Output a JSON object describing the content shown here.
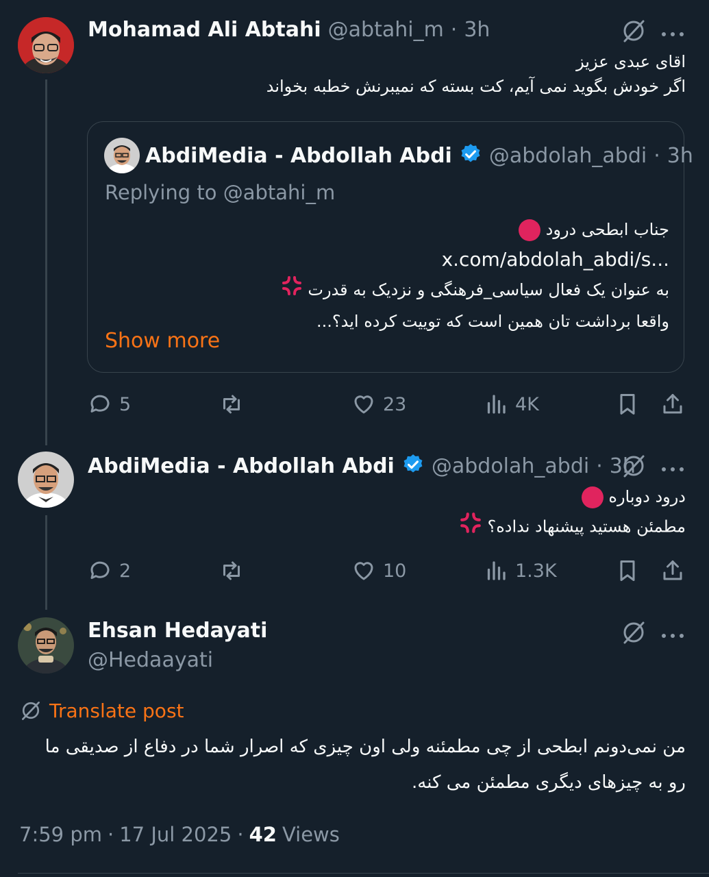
{
  "tweet1": {
    "name": "Mohamad Ali Abtahi",
    "handle": "@abtahi_m",
    "dot": "·",
    "time": "3h",
    "lines": [
      "اقای عبدی عزیز",
      "اگر خودش بگوید نمی آیم، کت بسته که نمیبرنش خطبه بخواند"
    ],
    "quote": {
      "name": "AbdiMedia - Abdollah Abdi",
      "handle": "@abdolah_abdi",
      "dot": "·",
      "time": "3h",
      "replying": "Replying to @abtahi_m",
      "line1": "جناب ابطحی درود",
      "link": "x.com/abdolah_abdi/s...",
      "line3": "به عنوان یک فعال سیاسی_فرهنگی و نزدیک به قدرت",
      "line4": "واقعا برداشت تان همین است که توییت کرده اید؟...",
      "show_more": "Show more"
    },
    "stats": {
      "replies": "5",
      "likes": "23",
      "views": "4K"
    }
  },
  "tweet2": {
    "name": "AbdiMedia - Abdollah Abdi",
    "handle": "@abdolah_abdi",
    "dot": "·",
    "time": "3h",
    "line1": "درود دوباره",
    "line2": "مطمئن هستید پیشنهاد نداده؟",
    "stats": {
      "replies": "2",
      "likes": "10",
      "views": "1.3K"
    }
  },
  "tweet3": {
    "name": "Ehsan Hedayati",
    "handle": "@Hedaayati",
    "translate": "Translate post",
    "body_line1": "من نمی‌دونم ابطحی از چی مطمئنه ولی اون چیزی که اصرار شما در دفاع از صدیقی ما",
    "body_line2": "رو به چیزهای دیگری مطمئن می کنه.",
    "time": "7:59 pm",
    "date": "17 Jul 2025",
    "dot": "·",
    "views_count": "42",
    "views_label": "Views"
  },
  "colors": {
    "background": "#15202b",
    "accent": "#f97316",
    "verified": "#1d9bf0",
    "muted": "#8b98a5"
  }
}
